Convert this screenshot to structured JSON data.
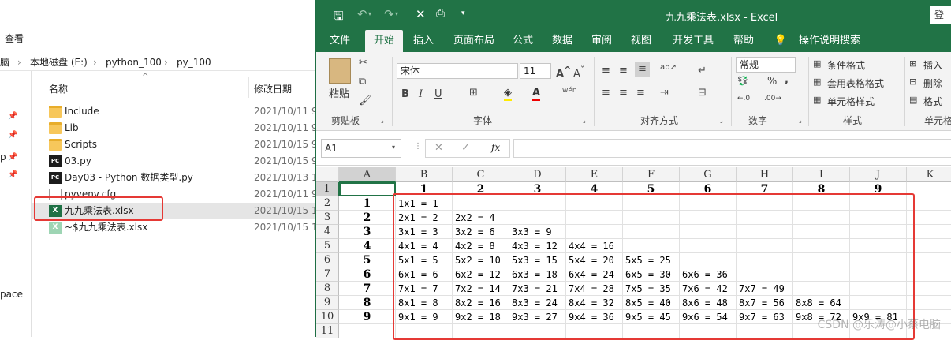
{
  "explorer": {
    "menu_view": "查看",
    "address": [
      "脑",
      "本地磁盘 (E:)",
      "python_100",
      "py_100"
    ],
    "nav_partial": [
      "p",
      "pace"
    ],
    "col_name": "名称",
    "col_date": "修改日期",
    "files": [
      {
        "name": "Include",
        "date": "2021/10/11 9",
        "icon": "folder-icon"
      },
      {
        "name": "Lib",
        "date": "2021/10/11 9",
        "icon": "folder-icon"
      },
      {
        "name": "Scripts",
        "date": "2021/10/15 9",
        "icon": "folder-icon"
      },
      {
        "name": "03.py",
        "date": "2021/10/15 9",
        "icon": "pycharm-icon"
      },
      {
        "name": "Day03 - Python 数据类型.py",
        "date": "2021/10/13 1",
        "icon": "pycharm-icon"
      },
      {
        "name": "pyvenv.cfg",
        "date": "2021/10/11 9",
        "icon": "cfg-file-icon"
      },
      {
        "name": "九九乘法表.xlsx",
        "date": "2021/10/15 1",
        "icon": "excel-file-icon"
      },
      {
        "name": "~$九九乘法表.xlsx",
        "date": "2021/10/15 1",
        "icon": "excel-temp-file-icon"
      }
    ]
  },
  "excel": {
    "title": "九九乘法表.xlsx  -  Excel",
    "login": "登",
    "tabs": [
      "文件",
      "开始",
      "插入",
      "页面布局",
      "公式",
      "数据",
      "审阅",
      "视图",
      "开发工具",
      "帮助",
      "操作说明搜索"
    ],
    "ribbon": {
      "paste": "粘贴",
      "clipboard": "剪贴板",
      "font_name": "宋体",
      "font_size": "11",
      "font_group": "字体",
      "align_group": "对齐方式",
      "number_format": "常规",
      "number_group": "数字",
      "cond_format": "条件格式",
      "table_format": "套用表格格式",
      "cell_style": "单元格样式",
      "style_group": "样式",
      "insert": "插入",
      "delete": "删除",
      "format": "格式",
      "cells_group": "单元格",
      "bold": "B",
      "italic": "I",
      "underline": "U",
      "wen": "wén",
      "pct": "%",
      "comma": ","
    },
    "name_box": "A1",
    "fx": "fx",
    "columns": [
      "A",
      "B",
      "C",
      "D",
      "E",
      "F",
      "G",
      "H",
      "I",
      "J",
      "K"
    ],
    "rows": [
      "1",
      "2",
      "3",
      "4",
      "5",
      "6",
      "7",
      "8",
      "9",
      "10",
      "11"
    ],
    "header_row": [
      "",
      "1",
      "2",
      "3",
      "4",
      "5",
      "6",
      "7",
      "8",
      "9"
    ],
    "col_a": [
      "",
      "1",
      "2",
      "3",
      "4",
      "5",
      "6",
      "7",
      "8",
      "9"
    ],
    "table": [
      [
        "1x1 = 1"
      ],
      [
        "2x1 = 2",
        "2x2 = 4"
      ],
      [
        "3x1 = 3",
        "3x2 = 6",
        "3x3 = 9"
      ],
      [
        "4x1 = 4",
        "4x2 = 8",
        "4x3 = 12",
        "4x4 = 16"
      ],
      [
        "5x1 = 5",
        "5x2 = 10",
        "5x3 = 15",
        "5x4 = 20",
        "5x5 = 25"
      ],
      [
        "6x1 = 6",
        "6x2 = 12",
        "6x3 = 18",
        "6x4 = 24",
        "6x5 = 30",
        "6x6 = 36"
      ],
      [
        "7x1 = 7",
        "7x2 = 14",
        "7x3 = 21",
        "7x4 = 28",
        "7x5 = 35",
        "7x6 = 42",
        "7x7 = 49"
      ],
      [
        "8x1 = 8",
        "8x2 = 16",
        "8x3 = 24",
        "8x4 = 32",
        "8x5 = 40",
        "8x6 = 48",
        "8x7 = 56",
        "8x8 = 64"
      ],
      [
        "9x1 = 9",
        "9x2 = 18",
        "9x3 = 27",
        "9x4 = 36",
        "9x5 = 45",
        "9x6 = 54",
        "9x7 = 63",
        "9x8 = 72",
        "9x9 = 81"
      ]
    ],
    "watermark": "CSDN @乐涛@小蔡电脑",
    "colors": {
      "excel_green": "#217346",
      "highlight_red": "#e53935"
    }
  }
}
